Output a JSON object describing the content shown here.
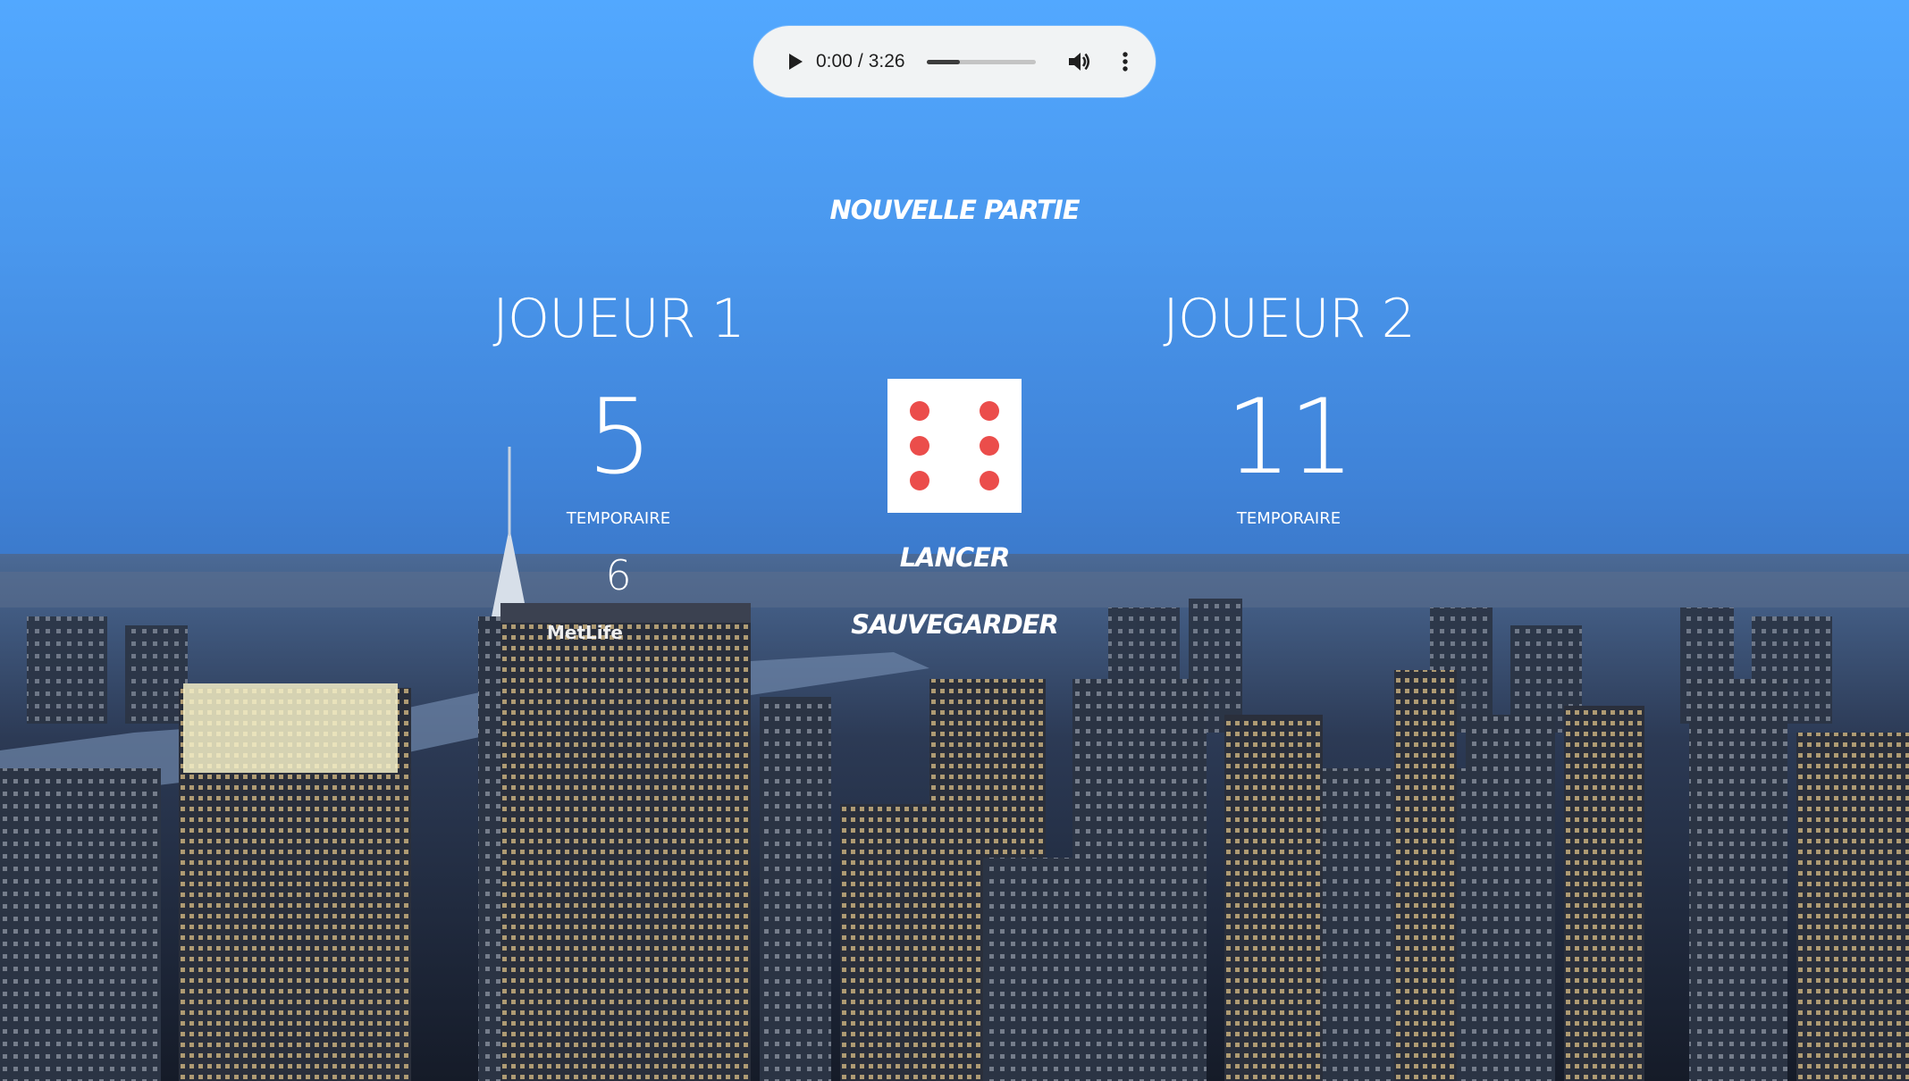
{
  "audio_player": {
    "current_time": "0:00",
    "separator": "/",
    "duration": "3:26",
    "progress_fraction": 0.3,
    "icons": {
      "play": "play-icon",
      "volume": "volume-icon",
      "more": "more-options-icon"
    }
  },
  "game": {
    "new_game_label": "NOUVELLE PARTIE",
    "roll_label": "LANCER",
    "save_label": "SAUVEGARDER",
    "dice_value": 6,
    "dice_pip_color": "#eb4d4b",
    "players": [
      {
        "name": "JOUEUR 1",
        "score": "5",
        "temp_label": "TEMPORAIRE",
        "temp_value": "6"
      },
      {
        "name": "JOUEUR 2",
        "score": "11",
        "temp_label": "TEMPORAIRE",
        "temp_value": ""
      }
    ]
  }
}
